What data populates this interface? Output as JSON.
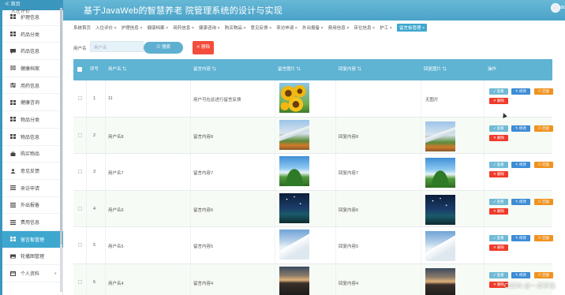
{
  "app": {
    "title": "基于JavaWeb的智慧养老 院管理系统的设计与实现",
    "user_initial": "ad"
  },
  "sidebar": {
    "home_label": "≪ 首页",
    "cut_label": "入住评价",
    "items": [
      {
        "label": "护理信息",
        "icon": "grid-icon"
      },
      {
        "label": "药品分类",
        "icon": "grid-icon"
      },
      {
        "label": "药品信息",
        "icon": "chat-icon"
      },
      {
        "label": "健康档案",
        "icon": "document-icon"
      },
      {
        "label": "用药信息",
        "icon": "sliders-icon"
      },
      {
        "label": "健康咨询",
        "icon": "grid-icon"
      },
      {
        "label": "物品分类",
        "icon": "grid-icon"
      },
      {
        "label": "物品信息",
        "icon": "grid-icon"
      },
      {
        "label": "购买物品",
        "icon": "bag-icon"
      },
      {
        "label": "意见反馈",
        "icon": "user-icon"
      },
      {
        "label": "来访申请",
        "icon": "list-icon"
      },
      {
        "label": "外出报备",
        "icon": "list-icon"
      },
      {
        "label": "费用信息",
        "icon": "list-icon"
      },
      {
        "label": "留言板管理",
        "icon": "grid-icon",
        "active": true
      },
      {
        "label": "轮播图管理",
        "icon": "image-icon"
      },
      {
        "label": "个人资料",
        "icon": "calendar-icon",
        "chevron": "∨"
      }
    ]
  },
  "tabs": [
    {
      "label": "系统首页"
    },
    {
      "label": "入住评价 ×"
    },
    {
      "label": "护理信息 ×"
    },
    {
      "label": "健康档案 ×"
    },
    {
      "label": "用药信息 ×"
    },
    {
      "label": "健康咨询 ×"
    },
    {
      "label": "购买物品 ×"
    },
    {
      "label": "意见反馈 ×"
    },
    {
      "label": "来访申请 ×"
    },
    {
      "label": "外出报备 ×"
    },
    {
      "label": "费用信息 ×"
    },
    {
      "label": "床位信息 ×"
    },
    {
      "label": "护工 ×"
    },
    {
      "label": "留言板管理 ×",
      "active": true
    }
  ],
  "search": {
    "label": "用户名",
    "placeholder": "用户名",
    "search_button": "⊙ 搜索",
    "delete_button": "✕ 删除"
  },
  "table": {
    "headers": [
      "序号",
      "用户名 ⇅",
      "留言内容 ⇅",
      "留言图片 ⇅",
      "回复内容 ⇅",
      "回复图片 ⇅",
      "操作"
    ],
    "rows": [
      {
        "index": "1",
        "user": "11",
        "message": "用户可在此进行留言反馈",
        "reply": "",
        "reply_img_text": "无图片",
        "msg_img": "sunflower",
        "reply_img": "none"
      },
      {
        "index": "2",
        "user": "用户名8",
        "message": "留言内容8",
        "reply": "回复内容8",
        "reply_img_text": "",
        "msg_img": "mountain",
        "reply_img": "mountain"
      },
      {
        "index": "3",
        "user": "用户名7",
        "message": "留言内容7",
        "reply": "回复内容7",
        "reply_img_text": "",
        "msg_img": "meadow",
        "reply_img": "meadow"
      },
      {
        "index": "4",
        "user": "用户名6",
        "message": "留言内容6",
        "reply": "回复内容6",
        "reply_img_text": "",
        "msg_img": "night",
        "reply_img": "night"
      },
      {
        "index": "5",
        "user": "用户名5",
        "message": "留言内容5",
        "reply": "回复内容5",
        "reply_img_text": "",
        "msg_img": "snow",
        "reply_img": "snow"
      },
      {
        "index": "6",
        "user": "用户名4",
        "message": "留言内容4",
        "reply": "回复内容4",
        "reply_img_text": "",
        "msg_img": "sunset",
        "reply_img": "sunset"
      }
    ],
    "actions": {
      "view": "✓ 查看",
      "edit": "✎ 修改",
      "reply": "⊙ 回复",
      "delete": "✕ 删除"
    }
  },
  "watermark": "CSDN @一点毕设",
  "colors": {
    "header": "#4aa3c8",
    "accent": "#3ea7cf",
    "danger": "#f34d3c",
    "warning": "#f0921f",
    "primary": "#3d8cd6"
  }
}
